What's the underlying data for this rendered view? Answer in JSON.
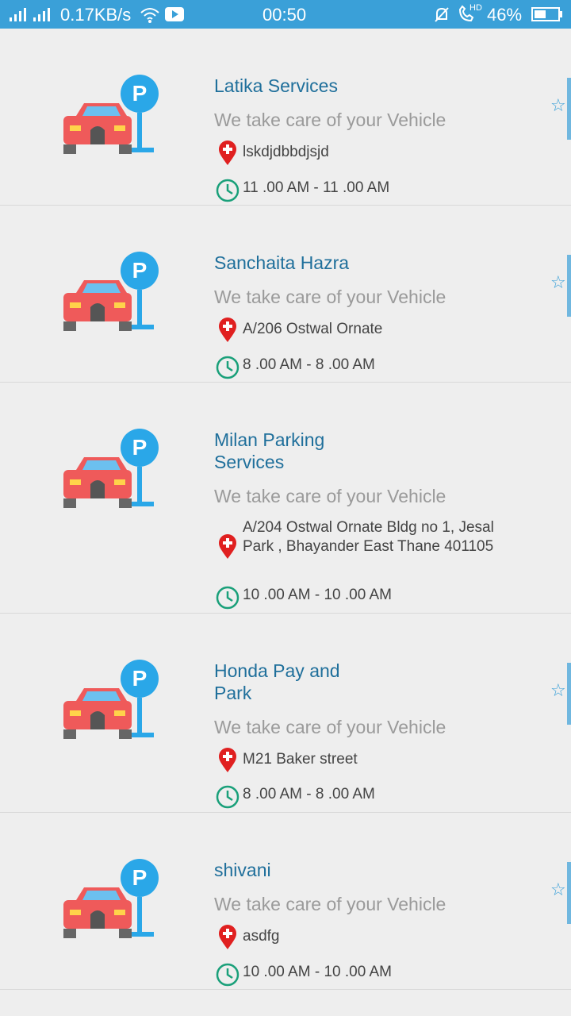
{
  "status_bar": {
    "network_speed": "0.17KB/s",
    "time": "00:50",
    "battery": "46%",
    "hd_label": "HD"
  },
  "listings": [
    {
      "name": "Latika Services",
      "tagline": "We take care of your Vehicle",
      "address": "lskdjdbbdjsjd",
      "hours": "11 .00 AM - 11 .00 AM"
    },
    {
      "name": "Sanchaita Hazra",
      "tagline": "We take care of your Vehicle",
      "address": "A/206 Ostwal Ornate",
      "hours": "8 .00 AM - 8 .00 AM"
    },
    {
      "name": "Milan Parking Services",
      "tagline": "We take care of your Vehicle",
      "address": "A/204 Ostwal Ornate Bldg no 1, Jesal Park , Bhayander East Thane 401105",
      "hours": "10 .00 AM - 10 .00 AM"
    },
    {
      "name": "Honda Pay and Park",
      "tagline": "We take care of your Vehicle",
      "address": "M21 Baker street",
      "hours": "8 .00 AM - 8 .00 AM"
    },
    {
      "name": "shivani",
      "tagline": "We take care of your Vehicle",
      "address": "asdfg",
      "hours": "10 .00 AM - 10 .00 AM"
    }
  ],
  "icons": {
    "logo": "car-parking-icon",
    "address": "location-pin-icon",
    "hours": "clock-icon",
    "rating": "star-icon"
  },
  "colors": {
    "status_bar": "#3aa0d8",
    "title": "#1f6f9b",
    "pin": "#e02020",
    "clock": "#1aa07a",
    "car": "#ef5a5a"
  }
}
